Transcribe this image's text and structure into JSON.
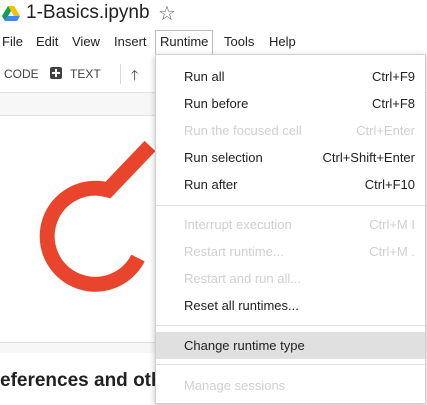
{
  "notebook": {
    "title": "1-Basics.ipynb",
    "star_icon": "star-icon"
  },
  "menubar": {
    "items": [
      "File",
      "Edit",
      "View",
      "Insert",
      "Runtime",
      "Tools",
      "Help"
    ],
    "active": "Runtime"
  },
  "toolbar": {
    "code_label": "CODE",
    "text_label": "TEXT"
  },
  "content": {
    "heading": "eferences and oth"
  },
  "runtime_menu": {
    "items": [
      {
        "label": "Run all",
        "shortcut": "Ctrl+F9",
        "enabled": true
      },
      {
        "label": "Run before",
        "shortcut": "Ctrl+F8",
        "enabled": true
      },
      {
        "label": "Run the focused cell",
        "shortcut": "Ctrl+Enter",
        "enabled": false
      },
      {
        "label": "Run selection",
        "shortcut": "Ctrl+Shift+Enter",
        "enabled": true
      },
      {
        "label": "Run after",
        "shortcut": "Ctrl+F10",
        "enabled": true
      },
      {
        "label": "Interrupt execution",
        "shortcut": "Ctrl+M I",
        "enabled": false
      },
      {
        "label": "Restart runtime...",
        "shortcut": "Ctrl+M .",
        "enabled": false
      },
      {
        "label": "Restart and run all...",
        "shortcut": "",
        "enabled": false
      },
      {
        "label": "Reset all runtimes...",
        "shortcut": "",
        "enabled": true
      },
      {
        "label": "Change runtime type",
        "shortcut": "",
        "enabled": true,
        "highlighted": true
      },
      {
        "label": "Manage sessions",
        "shortcut": "",
        "enabled": false
      }
    ]
  },
  "colors": {
    "accent": "#e8452c",
    "highlight": "#e0e0e0",
    "disabled_text": "#d0d0d0"
  }
}
